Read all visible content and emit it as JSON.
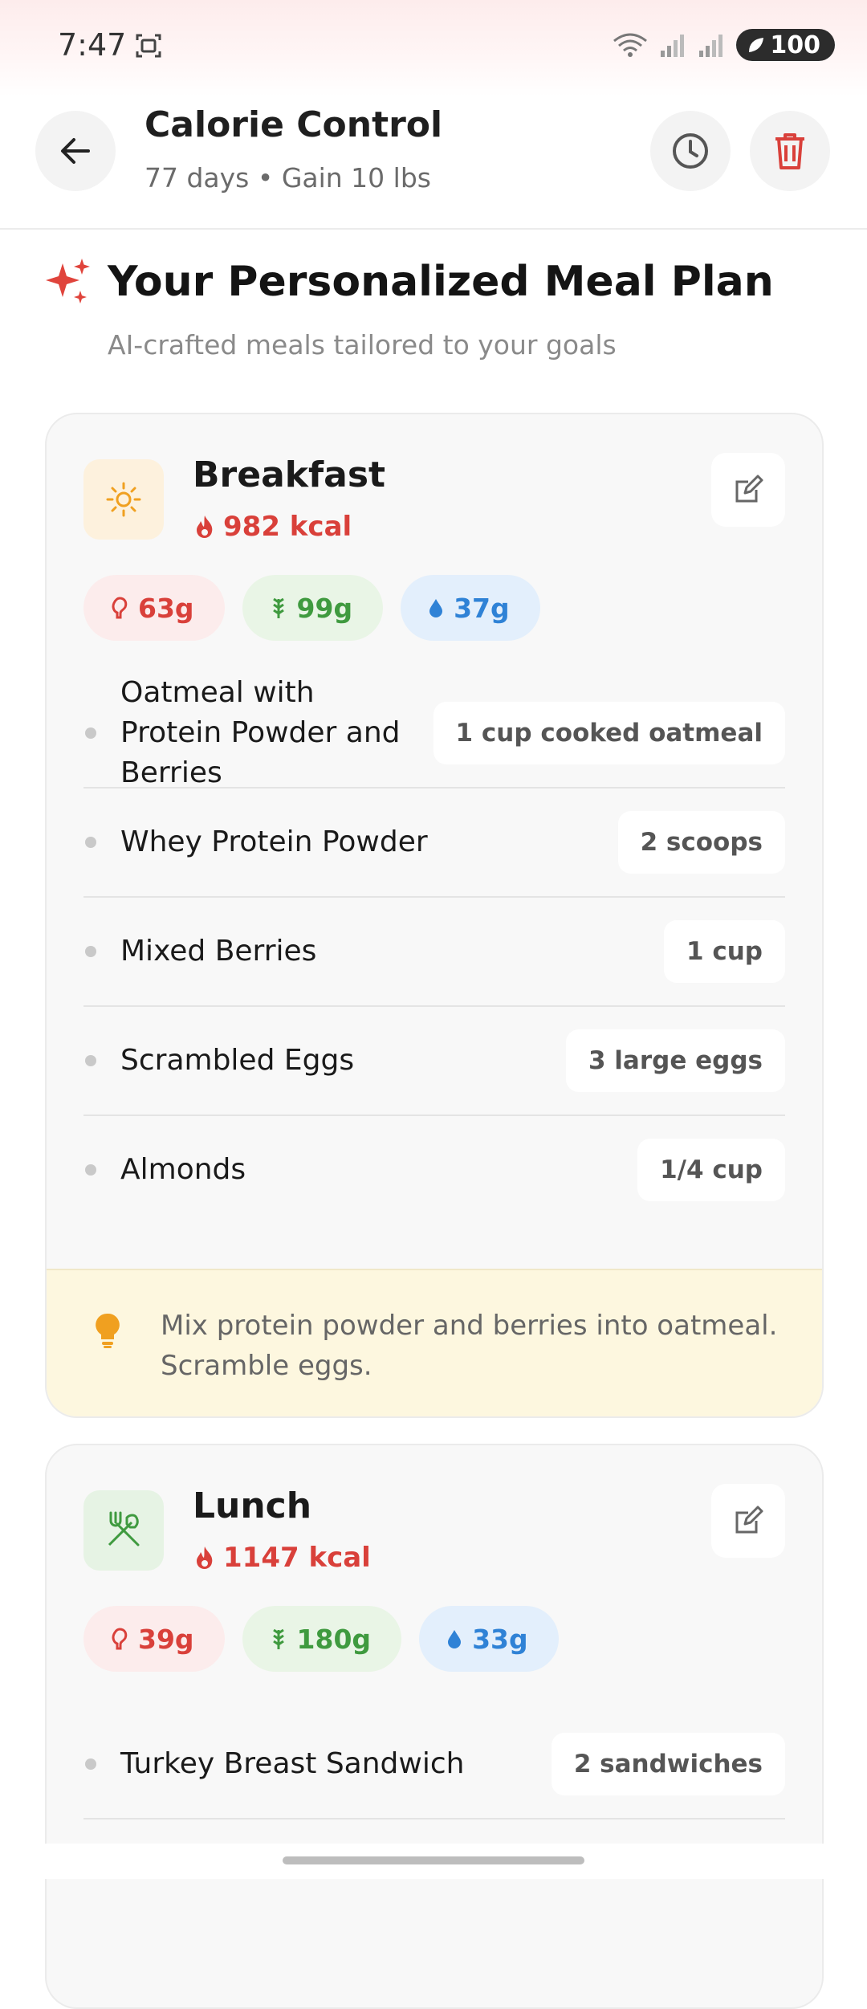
{
  "status": {
    "time": "7:47",
    "battery": "100"
  },
  "header": {
    "title": "Calorie Control",
    "subtitle": "77 days • Gain 10 lbs"
  },
  "plan": {
    "title": "Your Personalized Meal Plan",
    "subtitle": "AI-crafted meals tailored to your goals"
  },
  "meals": [
    {
      "name": "Breakfast",
      "kcal": "982 kcal",
      "macros": {
        "protein": "63g",
        "carbs": "99g",
        "fat": "37g"
      },
      "items": [
        {
          "name": "Oatmeal with Protein Powder and Berries",
          "qty": "1 cup cooked oatmeal"
        },
        {
          "name": "Whey Protein Powder",
          "qty": "2 scoops"
        },
        {
          "name": "Mixed Berries",
          "qty": "1 cup"
        },
        {
          "name": "Scrambled Eggs",
          "qty": "3 large eggs"
        },
        {
          "name": "Almonds",
          "qty": "1/4 cup"
        }
      ],
      "tip": "Mix protein powder and berries into oatmeal. Scramble eggs."
    },
    {
      "name": "Lunch",
      "kcal": "1147 kcal",
      "macros": {
        "protein": "39g",
        "carbs": "180g",
        "fat": "33g"
      },
      "items": [
        {
          "name": "Turkey Breast Sandwich",
          "qty": "2 sandwiches"
        }
      ]
    }
  ],
  "colors": {
    "accent": "#d9403a",
    "protein": "#d9403a",
    "carbs": "#3f9a3f",
    "fat": "#2f82d6",
    "tip_bg": "#fdf7df"
  }
}
